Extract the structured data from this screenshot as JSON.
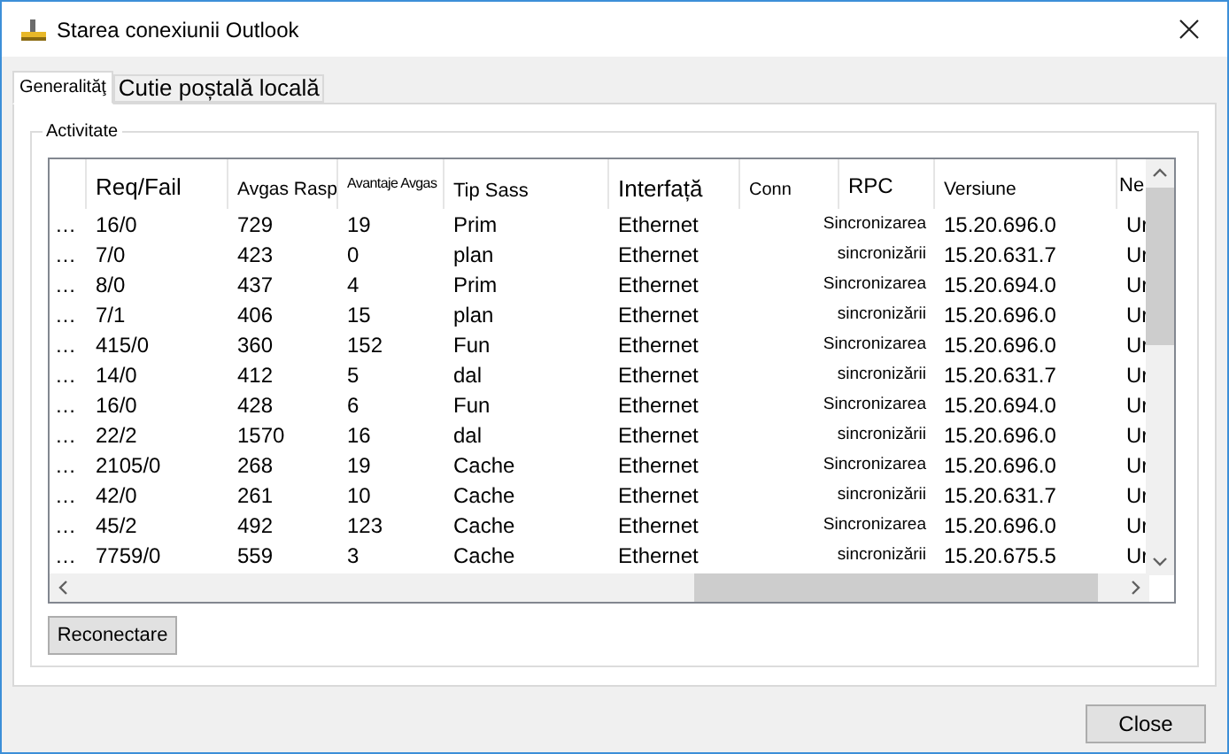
{
  "window": {
    "title": "Starea conexiunii Outlook"
  },
  "tabs": [
    {
      "label": "Generalităţ",
      "selected": true
    },
    {
      "label": "Cutie poștală locală",
      "selected": false
    }
  ],
  "group": {
    "title": "Activitate"
  },
  "list": {
    "columns": [
      "Req/Fail",
      "Avgas Rasp",
      "Avantaje Avgas",
      "Tip Sass",
      "Interfață",
      "Conn",
      "RPC",
      "Versiune",
      "Ne"
    ],
    "rows": [
      {
        "more": "…",
        "req_fail": "16/0",
        "avgas_rasp": "729",
        "avantaje_avgas": "19",
        "tip_sass": "Prim",
        "interface": "Ethernet",
        "rpc": "Sincronizarea",
        "version": "15.20.696.0",
        "column_10": "Ur"
      },
      {
        "more": "…",
        "req_fail": "7/0",
        "avgas_rasp": "423",
        "avantaje_avgas": "0",
        "tip_sass": "plan",
        "interface": "Ethernet",
        "rpc": "sincronizării",
        "version": "15.20.631.7",
        "column_10": "Ur"
      },
      {
        "more": "…",
        "req_fail": "8/0",
        "avgas_rasp": "437",
        "avantaje_avgas": "4",
        "tip_sass": "Prim",
        "interface": "Ethernet",
        "rpc": "Sincronizarea",
        "version": "15.20.694.0",
        "column_10": "Ur"
      },
      {
        "more": "…",
        "req_fail": "7/1",
        "avgas_rasp": "406",
        "avantaje_avgas": "15",
        "tip_sass": "plan",
        "interface": "Ethernet",
        "rpc": "sincronizării",
        "version": "15.20.696.0",
        "column_10": "Ur"
      },
      {
        "more": "…",
        "req_fail": "415/0",
        "avgas_rasp": "360",
        "avantaje_avgas": "152",
        "tip_sass": "Fun",
        "interface": "Ethernet",
        "rpc": "Sincronizarea",
        "version": "15.20.696.0",
        "column_10": "Ur"
      },
      {
        "more": "…",
        "req_fail": "14/0",
        "avgas_rasp": "412",
        "avantaje_avgas": "5",
        "tip_sass": "dal",
        "interface": "Ethernet",
        "rpc": "sincronizării",
        "version": "15.20.631.7",
        "column_10": "Ur"
      },
      {
        "more": "…",
        "req_fail": "16/0",
        "avgas_rasp": "428",
        "avantaje_avgas": "6",
        "tip_sass": "Fun",
        "interface": "Ethernet",
        "rpc": "Sincronizarea",
        "version": "15.20.694.0",
        "column_10": "Ur"
      },
      {
        "more": "…",
        "req_fail": "22/2",
        "avgas_rasp": "1570",
        "avantaje_avgas": "16",
        "tip_sass": "dal",
        "interface": "Ethernet",
        "rpc": "sincronizării",
        "version": "15.20.696.0",
        "column_10": "Ur"
      },
      {
        "more": "…",
        "req_fail": "2105/0",
        "avgas_rasp": "268",
        "avantaje_avgas": "19",
        "tip_sass": "Cache",
        "interface": "Ethernet",
        "rpc": "Sincronizarea",
        "version": "15.20.696.0",
        "column_10": "Ur"
      },
      {
        "more": "…",
        "req_fail": "42/0",
        "avgas_rasp": "261",
        "avantaje_avgas": "10",
        "tip_sass": "Cache",
        "interface": "Ethernet",
        "rpc": "sincronizării",
        "version": "15.20.631.7",
        "column_10": "Ur"
      },
      {
        "more": "…",
        "req_fail": "45/2",
        "avgas_rasp": "492",
        "avantaje_avgas": "123",
        "tip_sass": "Cache",
        "interface": "Ethernet",
        "rpc": "Sincronizarea",
        "version": "15.20.696.0",
        "column_10": "Ur"
      },
      {
        "more": "…",
        "req_fail": "7759/0",
        "avgas_rasp": "559",
        "avantaje_avgas": "3",
        "tip_sass": "Cache",
        "interface": "Ethernet",
        "rpc": "sincronizării",
        "version": "15.20.675.5",
        "column_10": "Ur"
      }
    ]
  },
  "buttons": {
    "reconnect": "Reconectare",
    "close": "Close"
  }
}
